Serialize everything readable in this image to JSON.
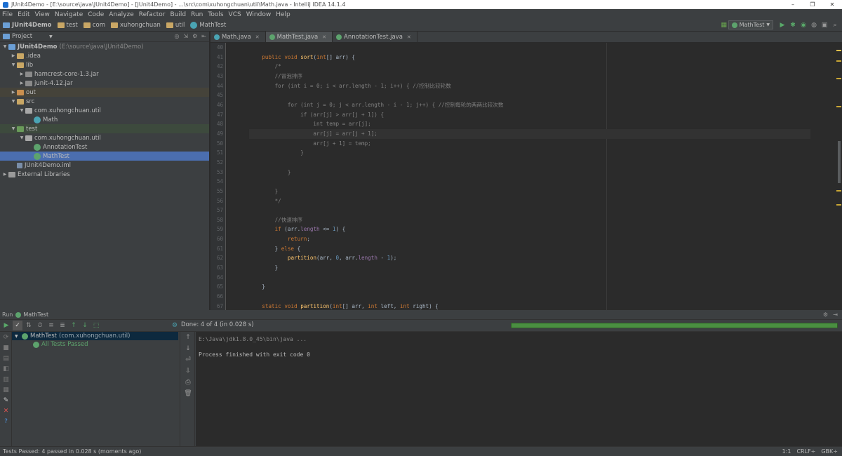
{
  "window": {
    "title": "JUnit4Demo - [E:\\source\\java\\JUnit4Demo] - [JUnit4Demo] - ...\\src\\com\\xuhongchuan\\util\\Math.java - IntelliJ IDEA 14.1.4",
    "controls": [
      "–",
      "❐",
      "✕"
    ]
  },
  "menu": [
    "File",
    "Edit",
    "View",
    "Navigate",
    "Code",
    "Analyze",
    "Refactor",
    "Build",
    "Run",
    "Tools",
    "VCS",
    "Window",
    "Help"
  ],
  "breadcrumbs": [
    "JUnit4Demo",
    "test",
    "com",
    "xuhongchuan",
    "util",
    "MathTest"
  ],
  "run_config": "MathTest",
  "project_panel": {
    "title": "Project",
    "tree": [
      {
        "label": "JUnit4Demo",
        "extra": "(E:\\source\\java\\JUnit4Demo)",
        "depth": 0,
        "type": "module",
        "open": true
      },
      {
        "label": ".idea",
        "depth": 1,
        "type": "folder",
        "open": false
      },
      {
        "label": "lib",
        "depth": 1,
        "type": "folder",
        "open": true
      },
      {
        "label": "hamcrest-core-1.3.jar",
        "depth": 2,
        "type": "jar",
        "open": false
      },
      {
        "label": "junit-4.12.jar",
        "depth": 2,
        "type": "jar",
        "open": false
      },
      {
        "label": "out",
        "depth": 1,
        "type": "folder",
        "open": false
      },
      {
        "label": "src",
        "depth": 1,
        "type": "folder",
        "open": true
      },
      {
        "label": "com.xuhongchuan.util",
        "depth": 2,
        "type": "package",
        "open": true
      },
      {
        "label": "Math",
        "depth": 3,
        "type": "class"
      },
      {
        "label": "test",
        "depth": 1,
        "type": "folder",
        "open": true
      },
      {
        "label": "com.xuhongchuan.util",
        "depth": 2,
        "type": "package",
        "open": true
      },
      {
        "label": "AnnotationTest",
        "depth": 3,
        "type": "class"
      },
      {
        "label": "MathTest",
        "depth": 3,
        "type": "class",
        "selected": true
      },
      {
        "label": "JUnit4Demo.iml",
        "depth": 1,
        "type": "file"
      },
      {
        "label": "External Libraries",
        "depth": 0,
        "type": "libs",
        "open": false
      }
    ]
  },
  "editor": {
    "tabs": [
      {
        "label": "Math.java",
        "active": false
      },
      {
        "label": "MathTest.java",
        "active": true
      },
      {
        "label": "AnnotationTest.java",
        "active": false
      }
    ],
    "line_numbers": [
      "40",
      "41",
      "42",
      "43",
      "44",
      "45",
      "46",
      "47",
      "48",
      "49",
      "50",
      "51",
      "52",
      "53",
      "54",
      "55",
      "56",
      "57",
      "58",
      "59",
      "60",
      "61",
      "62",
      "63",
      "64",
      "65",
      "66",
      "67"
    ],
    "lines": [
      "",
      "    public void sort(int[] arr) {",
      "        /*",
      "        //冒泡排序",
      "        for (int i = 0; i < arr.length - 1; i++) { //控制比较轮数",
      "",
      "            for (int j = 0; j < arr.length - i - 1; j++) { //控制每轮的两两比较次数",
      "                if (arr[j] > arr[j + 1]) {",
      "                    int temp = arr[j];",
      "                    arr[j] = arr[j + 1];",
      "                    arr[j + 1] = temp;",
      "                }",
      "",
      "            }",
      "",
      "        }",
      "        */",
      "",
      "        //快速排序",
      "        if (arr.length <= 1) {",
      "            return;",
      "        } else {",
      "            partition(arr, 0, arr.length - 1);",
      "        }",
      "",
      "    }",
      "",
      "    static void partition(int[] arr, int left, int right) {"
    ]
  },
  "run_panel": {
    "header_label": "Run",
    "header_tab": "MathTest",
    "done_text": "Done: 4 of 4 (in 0.028 s)",
    "progress_fraction": 1.0,
    "test_tree": [
      {
        "label": "MathTest",
        "extra": "(com.xuhongchuan.util)"
      },
      {
        "label": "All Tests Passed"
      }
    ],
    "console": [
      "E:\\Java\\jdk1.8.0_45\\bin\\java ...",
      "",
      "Process finished with exit code 0"
    ]
  },
  "status_bar": {
    "message": "Tests Passed: 4 passed in 0.028 s (moments ago)",
    "position": "1:1",
    "line_sep": "CRLF÷",
    "encoding": "GBK÷"
  },
  "colors": {
    "accent": "#4b6eaf",
    "pass": "#5da36d",
    "progress": "#4a8f41",
    "keyword": "#cc7832",
    "comment": "#808080"
  }
}
